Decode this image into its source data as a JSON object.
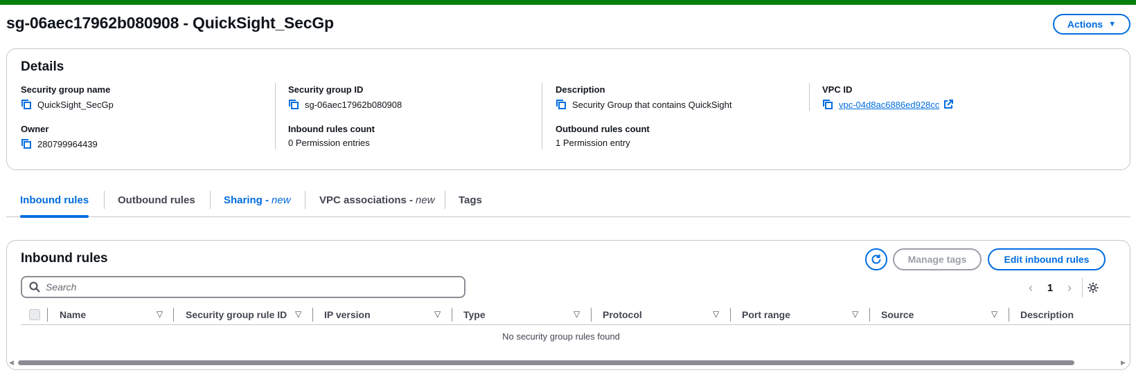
{
  "page": {
    "title": "sg-06aec17962b080908 - QuickSight_SecGp",
    "actions_label": "Actions",
    "flash_color": "#037f0c"
  },
  "details": {
    "heading": "Details",
    "fields": {
      "sg_name": {
        "label": "Security group name",
        "value": "QuickSight_SecGp"
      },
      "sg_id": {
        "label": "Security group ID",
        "value": "sg-06aec17962b080908"
      },
      "description": {
        "label": "Description",
        "value": "Security Group that contains QuickSight"
      },
      "vpc_id": {
        "label": "VPC ID",
        "value": "vpc-04d8ac6886ed928cc"
      },
      "owner": {
        "label": "Owner",
        "value": "280799964439"
      },
      "inbound_count": {
        "label": "Inbound rules count",
        "value": "0 Permission entries"
      },
      "outbound_count": {
        "label": "Outbound rules count",
        "value": "1 Permission entry"
      }
    }
  },
  "tabs": [
    {
      "label": "Inbound rules",
      "suffix": "",
      "active": true
    },
    {
      "label": "Outbound rules",
      "suffix": "",
      "active": false
    },
    {
      "label": "Sharing -",
      "suffix": "new",
      "active": false
    },
    {
      "label": "VPC associations -",
      "suffix": "new",
      "active": false
    },
    {
      "label": "Tags",
      "suffix": "",
      "active": false
    }
  ],
  "inbound": {
    "heading": "Inbound rules",
    "manage_tags_label": "Manage tags",
    "edit_label": "Edit inbound rules",
    "search_placeholder": "Search",
    "current_page": "1",
    "columns": [
      "Name",
      "Security group rule ID",
      "IP version",
      "Type",
      "Protocol",
      "Port range",
      "Source",
      "Description"
    ],
    "empty_message": "No security group rules found"
  },
  "icons": [
    "copy-icon",
    "external-link-icon",
    "refresh-icon",
    "search-icon",
    "chevron-left-icon",
    "chevron-right-icon",
    "gear-icon",
    "sort-down-icon",
    "caret-down-icon"
  ],
  "colors": {
    "accent": "#006ce0",
    "text": "#0f141a",
    "border": "#c6c6cd",
    "disabled": "#9ba0a8"
  }
}
